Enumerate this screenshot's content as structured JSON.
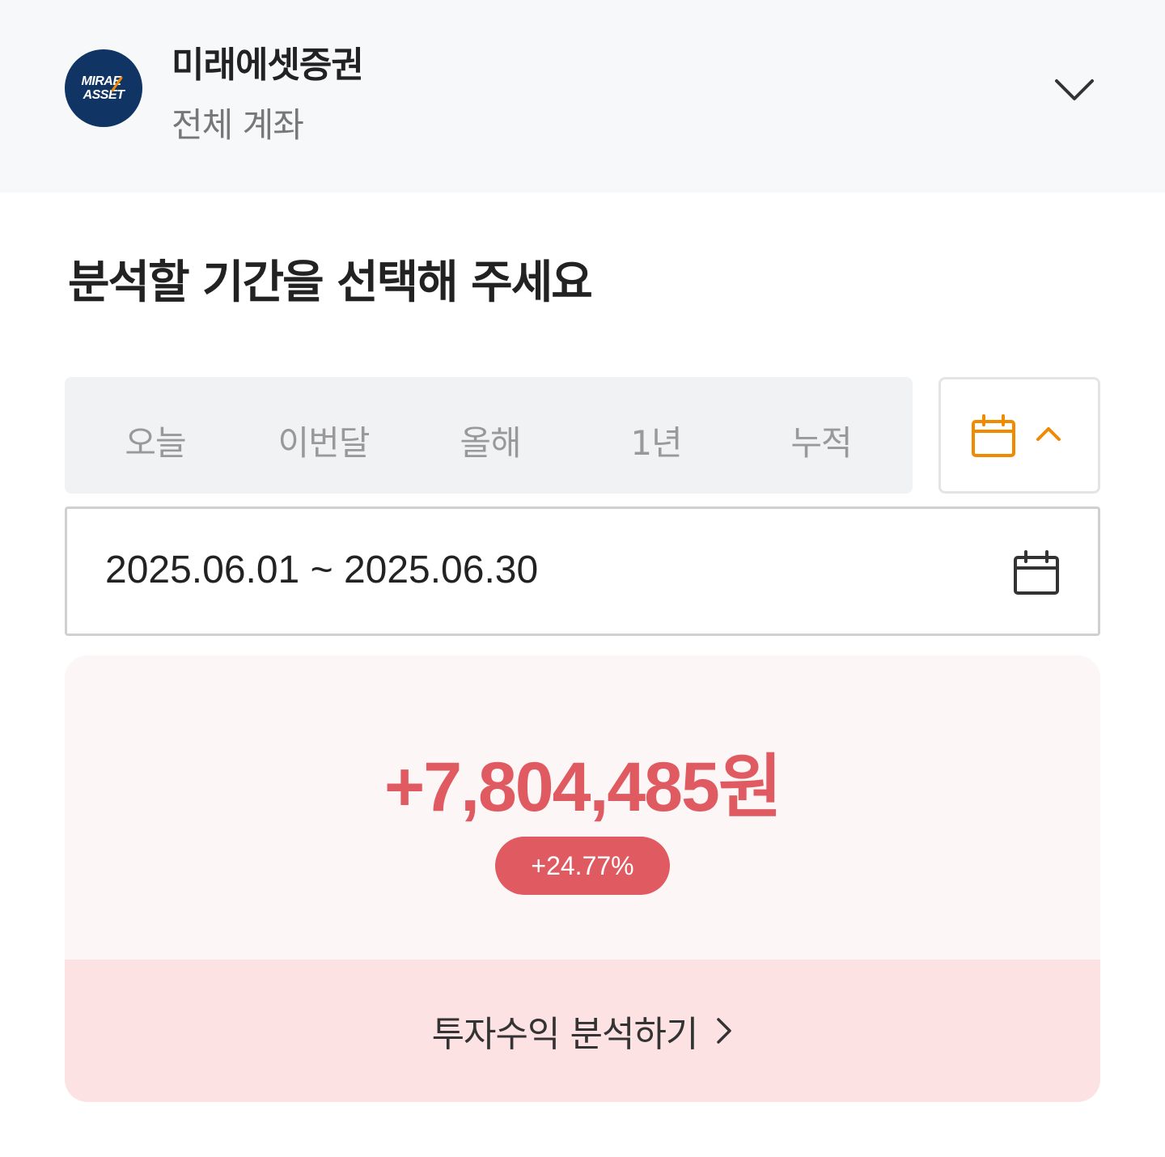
{
  "header": {
    "logo_text_line1": "MIRAE",
    "logo_text_line2": "ASSET",
    "broker_name": "미래에셋증권",
    "account_name": "전체 계좌",
    "dropdown_icon": "chevron-down-icon"
  },
  "section_title": "분석할 기간을 선택해 주세요",
  "period_tabs": [
    {
      "label": "오늘"
    },
    {
      "label": "이번달"
    },
    {
      "label": "올해"
    },
    {
      "label": "1년"
    },
    {
      "label": "누적"
    }
  ],
  "calendar_toggle": {
    "icon": "calendar-icon",
    "arrow_icon": "chevron-up-icon",
    "accent_color": "#f08a00"
  },
  "date_range": {
    "value": "2025.06.01 ~ 2025.06.30",
    "icon": "calendar-icon"
  },
  "result": {
    "amount": "+7,804,485원",
    "rate": "+24.77%",
    "positive_color": "#e05a61"
  },
  "analyze_button": {
    "label": "투자수익 분석하기",
    "icon": "chevron-right-icon"
  }
}
